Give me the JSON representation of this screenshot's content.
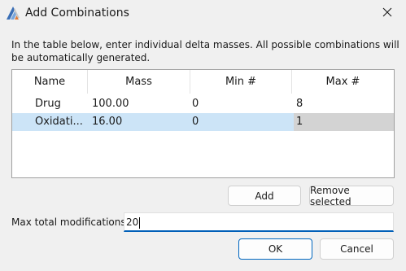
{
  "window": {
    "title": "Add Combinations",
    "close_icon": "close-icon",
    "app_icon": "app-icon"
  },
  "instructions": "In the table below, enter individual delta masses. All possible combinations will be automatically generated.",
  "table": {
    "columns": [
      "Name",
      "Mass",
      "Min #",
      "Max #"
    ],
    "rows": [
      {
        "name": "Drug",
        "mass": "100.00",
        "min": "0",
        "max": "8"
      },
      {
        "name": "Oxidati...",
        "mass": "16.00",
        "min": "0",
        "max": "1"
      }
    ],
    "selected_row": 1
  },
  "buttons": {
    "add": "Add",
    "remove_selected": "Remove selected",
    "ok": "OK",
    "cancel": "Cancel"
  },
  "max_total": {
    "label": "Max total modifications",
    "value": "20"
  },
  "colors": {
    "accent": "#005fb8",
    "selection": "#cce4f7"
  }
}
